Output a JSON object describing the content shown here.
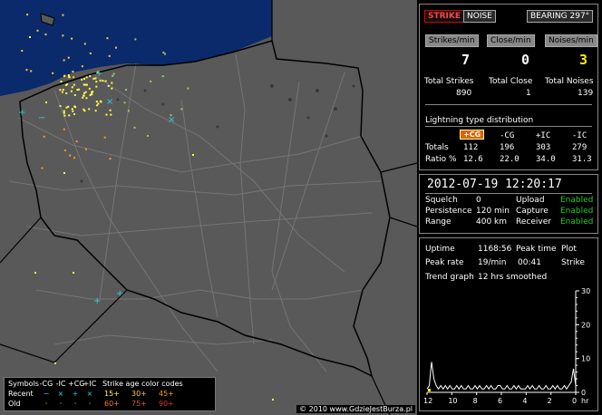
{
  "map": {
    "colors": {
      "land": "#595959",
      "sea": "#0b2a6b",
      "border": "#000000",
      "roads": "#757575",
      "yellow": "#ffff44",
      "orange": "#ff9922",
      "cyan": "#33ccdd"
    },
    "copyright": "© 2010 www.GdzieJestBurza.pl"
  },
  "legend": {
    "symbols_label": "Symbols",
    "columns": [
      "-CG",
      "-IC",
      "+CG",
      "+IC"
    ],
    "recent_label": "Recent",
    "old_label": "Old",
    "recent_symbols": [
      "−",
      "×",
      "+",
      "×"
    ],
    "old_symbols": [
      "·",
      "·",
      "·",
      "·"
    ],
    "age_label": "Strike age color codes",
    "age_recent": [
      "15+",
      "30+",
      "45+"
    ],
    "age_old": [
      "60+",
      "75+",
      "90+"
    ]
  },
  "top": {
    "strike_btn": "STRIKE",
    "noise_btn": "NOISE",
    "bearing_btn": "BEARING 297°",
    "strikes_min_btn": "Strikes/min",
    "close_min_btn": "Close/min",
    "noises_min_btn": "Noises/min",
    "strikes_min": "7",
    "close_min": "0",
    "noises_min": "3",
    "total_strikes_label": "Total Strikes",
    "total_close_label": "Total Close",
    "total_noises_label": "Total Noises",
    "total_strikes": "890",
    "total_close": "1",
    "total_noises": "139",
    "dist_title": "Lightning type distribution",
    "dist_cols": [
      "+CG",
      "-CG",
      "+IC",
      "-IC"
    ],
    "totals_label": "Totals",
    "ratio_label": "Ratio %",
    "totals": [
      "112",
      "196",
      "303",
      "279"
    ],
    "ratio": [
      "12.6",
      "22.0",
      "34.0",
      "31.3"
    ]
  },
  "status": {
    "datetime": "2012-07-19 12:20:17",
    "squelch_label": "Squelch",
    "squelch": "0",
    "persistence_label": "Persistence",
    "persistence": "120 min",
    "range_label": "Range",
    "range": "400 km",
    "upload_label": "Upload",
    "upload": "Enabled",
    "capture_label": "Capture",
    "capture": "Enabled",
    "receiver_label": "Receiver",
    "receiver": "Enabled"
  },
  "uptime": {
    "uptime_label": "Uptime",
    "uptime": "1168:56",
    "peak_time_label": "Peak time",
    "plot_label": "Plot",
    "peak_rate_label": "Peak rate",
    "peak_rate": "19/min",
    "peak_time": "00:41",
    "plot": "Strike",
    "trend_label": "Trend graph",
    "trend": "12 hrs smoothed"
  },
  "chart_data": {
    "type": "line",
    "xlabel": "hr",
    "x_ticks": [
      "12",
      "10",
      "8",
      "6",
      "4",
      "2",
      "0"
    ],
    "y_ticks": [
      "0",
      "10",
      "20",
      "30"
    ],
    "ylim": [
      0,
      30
    ],
    "series": [
      {
        "values": [
          1,
          2,
          9,
          4,
          2,
          1,
          2,
          1,
          2,
          1,
          2,
          1,
          1,
          2,
          1,
          2,
          1,
          1,
          2,
          1,
          1,
          2,
          1,
          2,
          1,
          1,
          2,
          1,
          2,
          1,
          1,
          2,
          2,
          1,
          1,
          2,
          1,
          1,
          2,
          1,
          2,
          1,
          1,
          1,
          2,
          1,
          2,
          1,
          1,
          2,
          1,
          1,
          2,
          1,
          1,
          2,
          1,
          2,
          1,
          1,
          2,
          1,
          2,
          3,
          7,
          2
        ]
      }
    ]
  }
}
